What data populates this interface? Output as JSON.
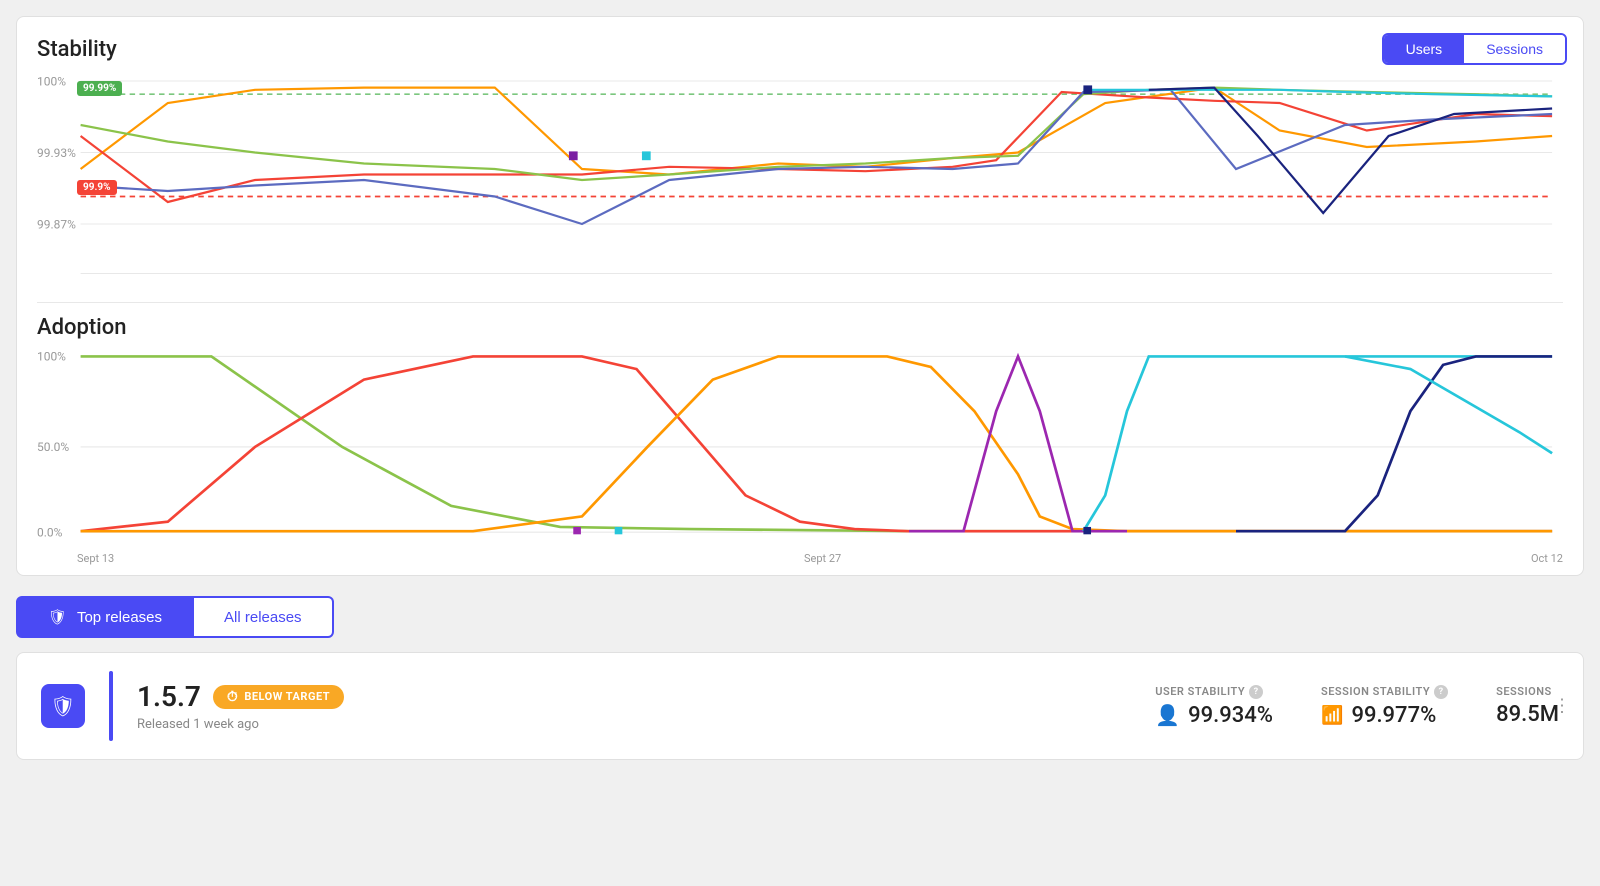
{
  "stability": {
    "title": "Stability",
    "badge_good": "99.99%",
    "badge_warn": "99.9%",
    "y_labels": [
      "100%",
      "99.93%",
      "99.87%"
    ],
    "ref_line_good": "99.99%",
    "ref_line_warn": "99.9%"
  },
  "adoption": {
    "title": "Adoption",
    "y_labels": [
      "100%",
      "50.0%",
      "0.0%"
    ]
  },
  "x_axis": {
    "start": "Sept 13",
    "mid": "Sept 27",
    "end": "Oct 12"
  },
  "toggle": {
    "users_label": "Users",
    "sessions_label": "Sessions"
  },
  "tabs": {
    "top_releases_label": "Top releases",
    "all_releases_label": "All releases"
  },
  "release": {
    "version": "1.5.7",
    "badge_label": "BELOW TARGET",
    "released_label": "Released 1 week ago",
    "user_stability_label": "USER STABILITY",
    "user_stability_value": "99.934%",
    "session_stability_label": "SESSION STABILITY",
    "session_stability_value": "99.977%",
    "sessions_label": "SESSIONS",
    "sessions_value": "89.5M"
  }
}
